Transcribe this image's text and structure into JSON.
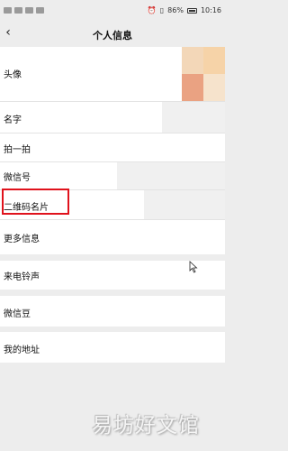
{
  "status_bar": {
    "battery": "86%",
    "time": "10:16"
  },
  "header": {
    "title": "个人信息",
    "back_icon": "chevron-left-icon"
  },
  "rows": [
    {
      "label": "头像"
    },
    {
      "label": "名字"
    },
    {
      "label": "拍一拍"
    },
    {
      "label": "微信号"
    },
    {
      "label": "二维码名片"
    },
    {
      "label": "更多信息"
    },
    {
      "label": "来电铃声"
    },
    {
      "label": "微信豆"
    },
    {
      "label": "我的地址"
    }
  ],
  "watermark": "易坊好文馆",
  "colors": {
    "highlight": "#e0121c",
    "background": "#ededed"
  }
}
